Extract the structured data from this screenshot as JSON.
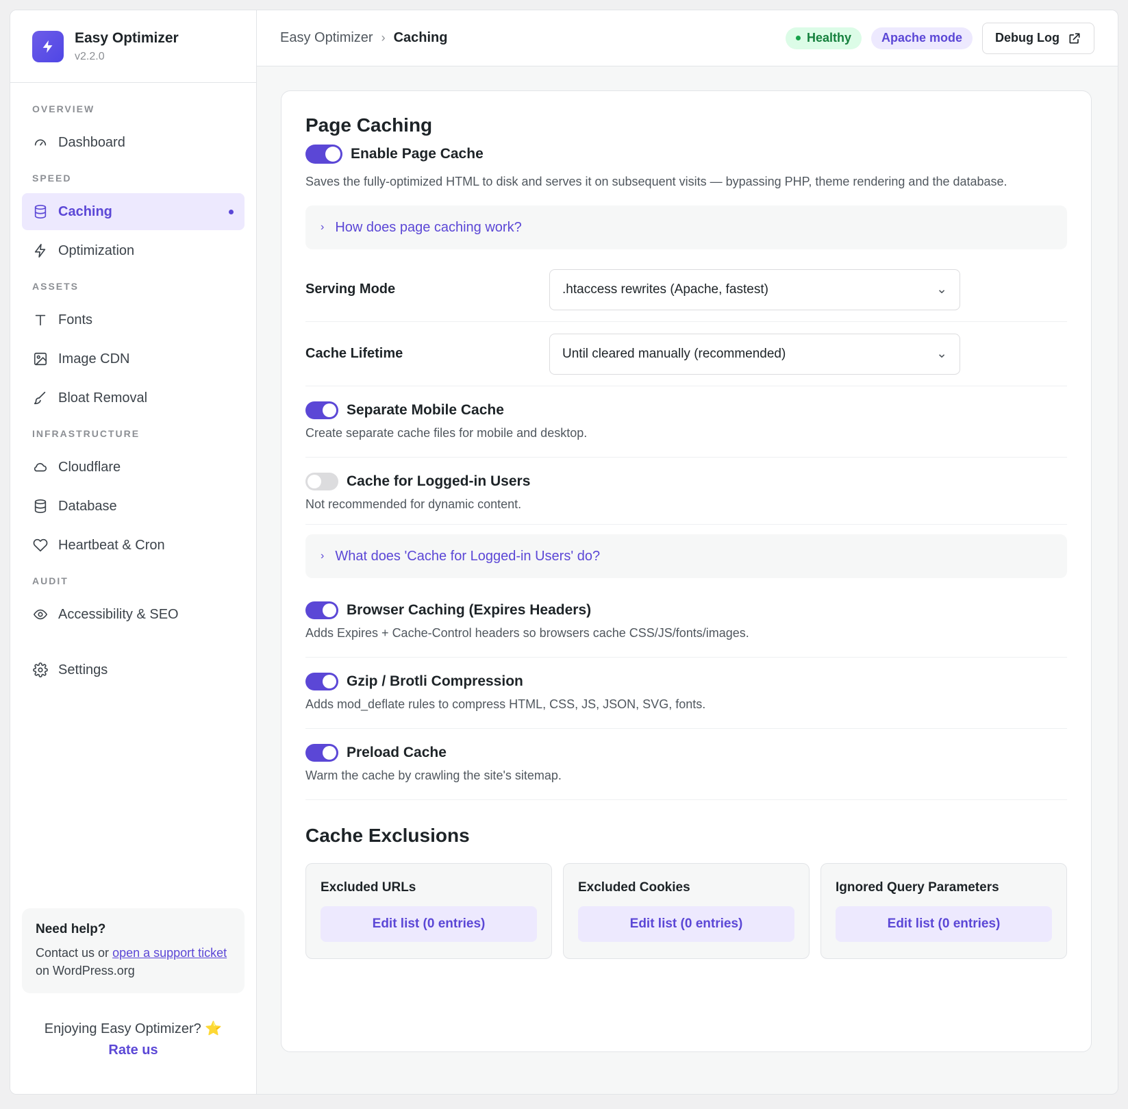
{
  "brand": {
    "name": "Easy Optimizer",
    "version": "v2.2.0"
  },
  "sidebar": {
    "sections": {
      "overview": "OVERVIEW",
      "speed": "SPEED",
      "assets": "ASSETS",
      "infrastructure": "INFRASTRUCTURE",
      "audit": "AUDIT"
    },
    "items": {
      "dashboard": {
        "label": "Dashboard",
        "icon": "gauge-icon"
      },
      "caching": {
        "label": "Caching",
        "icon": "database-icon"
      },
      "optimization": {
        "label": "Optimization",
        "icon": "bolt-icon"
      },
      "fonts": {
        "label": "Fonts",
        "icon": "type-icon"
      },
      "image_cdn": {
        "label": "Image CDN",
        "icon": "image-icon"
      },
      "bloat_removal": {
        "label": "Bloat Removal",
        "icon": "brush-icon"
      },
      "cloudflare": {
        "label": "Cloudflare",
        "icon": "cloud-icon"
      },
      "database": {
        "label": "Database",
        "icon": "database-icon"
      },
      "heartbeat": {
        "label": "Heartbeat & Cron",
        "icon": "heart-icon"
      },
      "accessibility": {
        "label": "Accessibility & SEO",
        "icon": "eye-icon"
      },
      "settings": {
        "label": "Settings",
        "icon": "gear-icon"
      }
    },
    "help": {
      "title": "Need help?",
      "text_before": "Contact us or ",
      "link": "open a support ticket",
      "text_after": " on WordPress.org"
    },
    "rate": {
      "text": "Enjoying Easy Optimizer?",
      "star": "⭐",
      "link": "Rate us"
    }
  },
  "header": {
    "breadcrumb_root": "Easy Optimizer",
    "breadcrumb_sep": "›",
    "breadcrumb_current": "Caching",
    "badge_healthy": "Healthy",
    "badge_apache": "Apache mode",
    "debug_button": "Debug Log"
  },
  "page_caching": {
    "title": "Page Caching",
    "enable_label": "Enable Page Cache",
    "enable_on": true,
    "description": "Saves the fully-optimized HTML to disk and serves it on subsequent visits — bypassing PHP, theme rendering and the database.",
    "faq1": "How does page caching work?",
    "serving_mode_label": "Serving Mode",
    "serving_mode_value": ".htaccess rewrites (Apache, fastest)",
    "cache_lifetime_label": "Cache Lifetime",
    "cache_lifetime_value": "Until cleared manually (recommended)",
    "options": [
      {
        "label": "Separate Mobile Cache",
        "desc": "Create separate cache files for mobile and desktop.",
        "on": true
      },
      {
        "label": "Cache for Logged-in Users",
        "desc": "Not recommended for dynamic content.",
        "on": false
      },
      {
        "label": "Browser Caching (Expires Headers)",
        "desc": "Adds Expires + Cache-Control headers so browsers cache CSS/JS/fonts/images.",
        "on": true
      },
      {
        "label": "Gzip / Brotli Compression",
        "desc": "Adds mod_deflate rules to compress HTML, CSS, JS, JSON, SVG, fonts.",
        "on": true
      },
      {
        "label": "Preload Cache",
        "desc": "Warm the cache by crawling the site's sitemap.",
        "on": true
      }
    ],
    "faq2": "What does 'Cache for Logged-in Users' do?"
  },
  "exclusions": {
    "title": "Cache Exclusions",
    "cards": [
      {
        "title": "Excluded URLs",
        "button": "Edit list (0 entries)"
      },
      {
        "title": "Excluded Cookies",
        "button": "Edit list (0 entries)"
      },
      {
        "title": "Ignored Query Parameters",
        "button": "Edit list (0 entries)"
      }
    ]
  },
  "colors": {
    "accent": "#5b47d6",
    "accent_light": "#ede9fe",
    "healthy": "#15803d",
    "healthy_bg": "#dcfce7"
  }
}
